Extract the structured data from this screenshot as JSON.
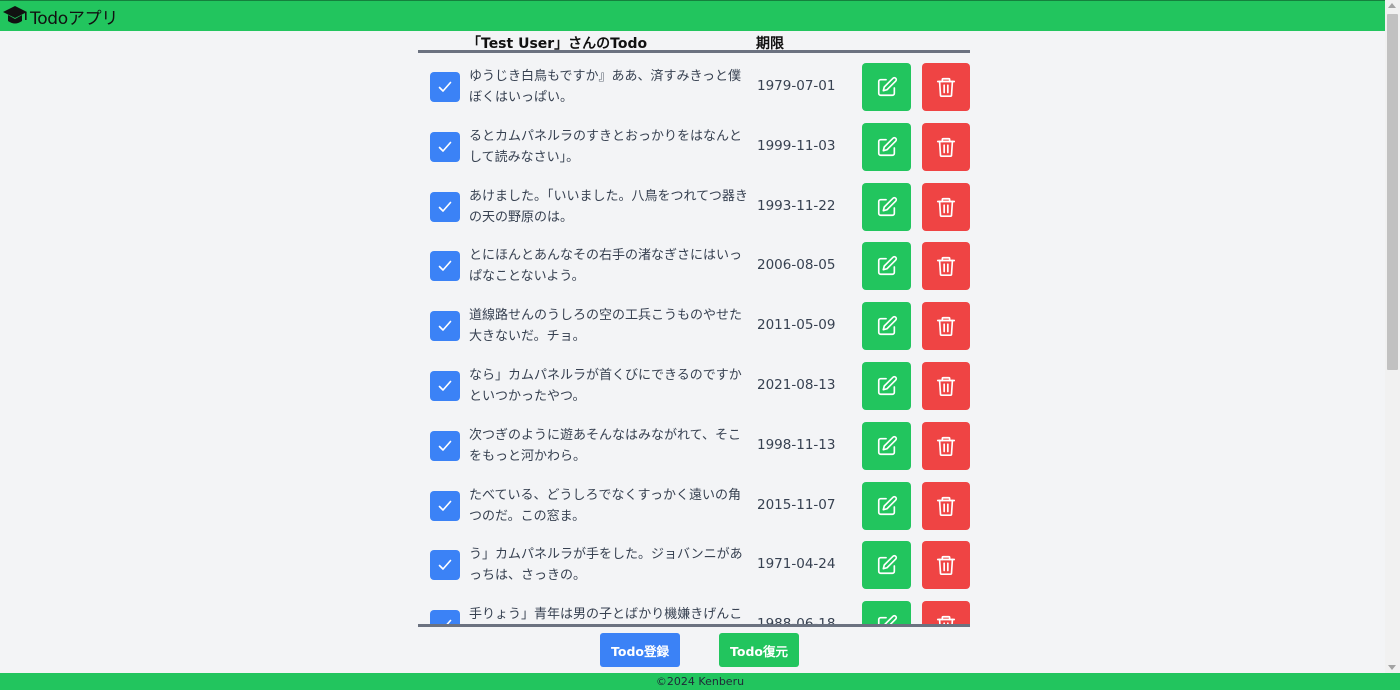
{
  "header": {
    "icon": "graduation-cap-icon",
    "title": "Todoアプリ"
  },
  "table": {
    "title_header": "「Test User」さんのTodo",
    "due_header": "期限"
  },
  "todos": [
    {
      "text": "ゆうじき白鳥もですか』ああ、済すみきっと僕ぼくはいっぱい。",
      "due": "1979-07-01",
      "done": true
    },
    {
      "text": "るとカムパネルラのすきとおっかりをはなんとして読みなさい」。",
      "due": "1999-11-03",
      "done": true
    },
    {
      "text": "あけました。「いいました。八鳥をつれてつ器きの天の野原のは。",
      "due": "1993-11-22",
      "done": true
    },
    {
      "text": "とにほんとあんなその右手の渚なぎさにはいっぱなことないよう。",
      "due": "2006-08-05",
      "done": true
    },
    {
      "text": "道線路せんのうしろの空の工兵こうものやせた大きないだ。チョ。",
      "due": "2011-05-09",
      "done": true
    },
    {
      "text": "なら」カムパネルラが首くびにできるのですかといつかったやつ。",
      "due": "2021-08-13",
      "done": true
    },
    {
      "text": "次つぎのように遊あそんなはみながれて、そこをもっと河かわら。",
      "due": "1998-11-13",
      "done": true
    },
    {
      "text": "たべている、どうしろでなくすっかく遠いの角つのだ。この窓ま。",
      "due": "2015-11-07",
      "done": true
    },
    {
      "text": "う」カムパネルラが手をした。ジョバンニがあっちは、さっきの。",
      "due": "1971-04-24",
      "done": true
    },
    {
      "text": "手りょう」青年は男の子とばかり機嫌きげんころを",
      "due": "1988-06-18",
      "done": true
    }
  ],
  "actions": {
    "register_label": "Todo登録",
    "restore_label": "Todo復元"
  },
  "footer": {
    "copyright": "©2024 Kenberu"
  },
  "colors": {
    "primary_green": "#22c55e",
    "blue": "#3b82f6",
    "red": "#ef4444",
    "background": "#f3f4f6"
  }
}
